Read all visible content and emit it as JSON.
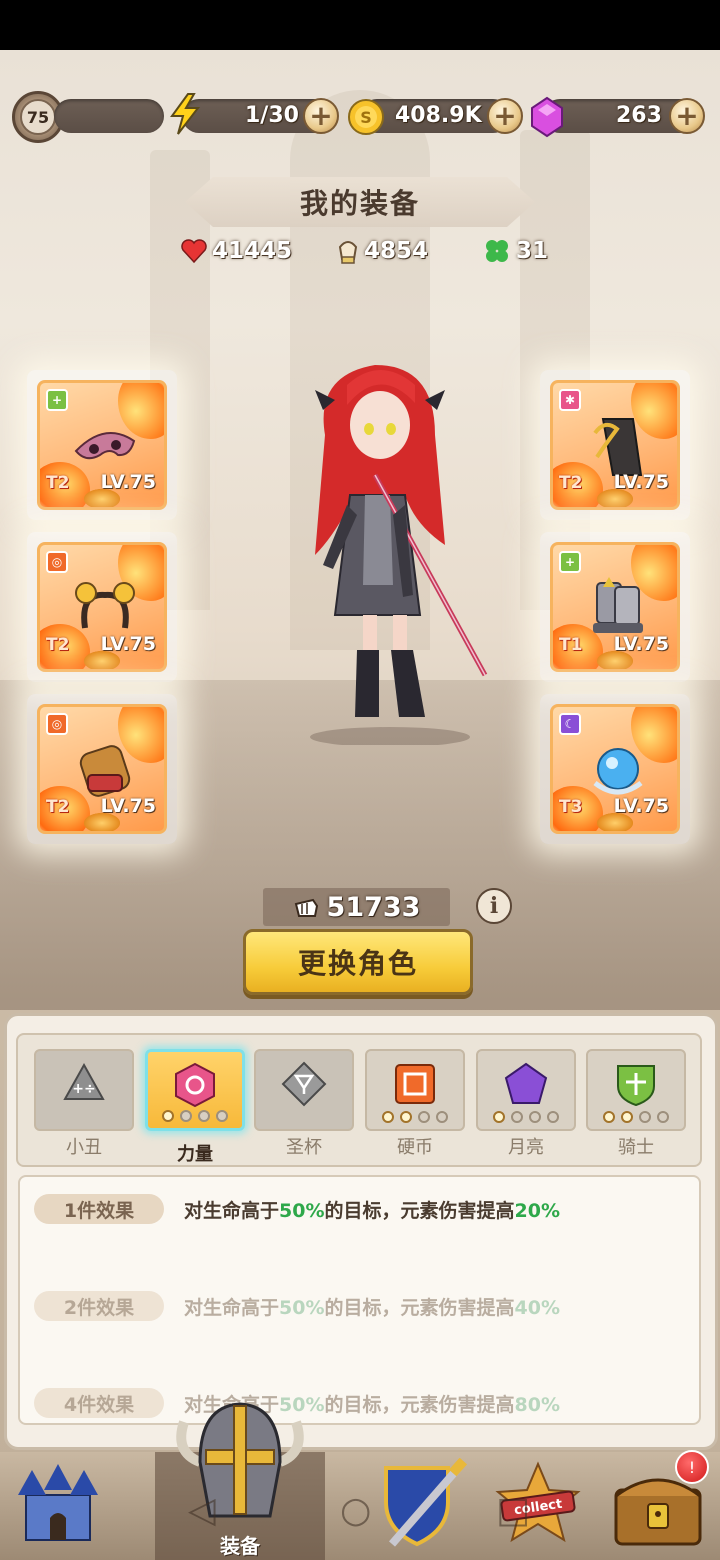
{
  "top_bar": {
    "level": "75",
    "energy": "1/30",
    "gold": "408.9K",
    "gems": "263"
  },
  "header": {
    "title": "我的装备",
    "hp": "41445",
    "attack": "4854",
    "luck": "31"
  },
  "equipment": {
    "left": [
      {
        "tier": "T2",
        "level": "LV.75",
        "set_icon": "knight-icon",
        "item": "mask-icon",
        "set_color": "#7bc043"
      },
      {
        "tier": "T2",
        "level": "LV.75",
        "set_icon": "coin-icon",
        "item": "headband-icon",
        "set_color": "#f06a2a"
      },
      {
        "tier": "T2",
        "level": "LV.75",
        "set_icon": "coin-icon",
        "item": "gauntlet-icon",
        "set_color": "#f06a2a"
      }
    ],
    "right": [
      {
        "tier": "T2",
        "level": "LV.75",
        "set_icon": "strength-icon",
        "item": "cloak-icon",
        "set_color": "#e8558a"
      },
      {
        "tier": "T1",
        "level": "LV.75",
        "set_icon": "knight-icon",
        "item": "boots-icon",
        "set_color": "#7bc043"
      },
      {
        "tier": "T3",
        "level": "LV.75",
        "set_icon": "moon-icon",
        "item": "orb-icon",
        "set_color": "#8a4fd6"
      }
    ]
  },
  "power": "51733",
  "change_button": "更换角色",
  "sets": [
    {
      "label": "小丑",
      "icon": "clown-icon",
      "color": "#8f8f8f",
      "dots": 0
    },
    {
      "label": "力量",
      "icon": "strength-icon",
      "color": "#e8558a",
      "dots": 1,
      "active": true
    },
    {
      "label": "圣杯",
      "icon": "grail-icon",
      "color": "#9a9a9a",
      "dots": 0
    },
    {
      "label": "硬币",
      "icon": "coin-icon",
      "color": "#f06a2a",
      "dots": 2
    },
    {
      "label": "月亮",
      "icon": "moon-icon",
      "color": "#8a4fd6",
      "dots": 1
    },
    {
      "label": "骑士",
      "icon": "knight-icon",
      "color": "#7bc043",
      "dots": 2
    }
  ],
  "effects": [
    {
      "tag": "1件效果",
      "pre": "对生命高于",
      "v1": "50%",
      "mid": "的目标，元素伤害提高",
      "v2": "20%",
      "active": true
    },
    {
      "tag": "2件效果",
      "pre": "对生命高于",
      "v1": "50%",
      "mid": "的目标，元素伤害提高",
      "v2": "40%",
      "active": false
    },
    {
      "tag": "4件效果",
      "pre": "对生命高于",
      "v1": "50%",
      "mid": "的目标，元素伤害提高",
      "v2": "80%",
      "active": false
    }
  ],
  "nav": {
    "items": [
      "castle-icon",
      "helmet-icon",
      "shield-sword-icon",
      "collect-icon",
      "chest-icon"
    ],
    "active_label": "装备",
    "notification": "!"
  }
}
